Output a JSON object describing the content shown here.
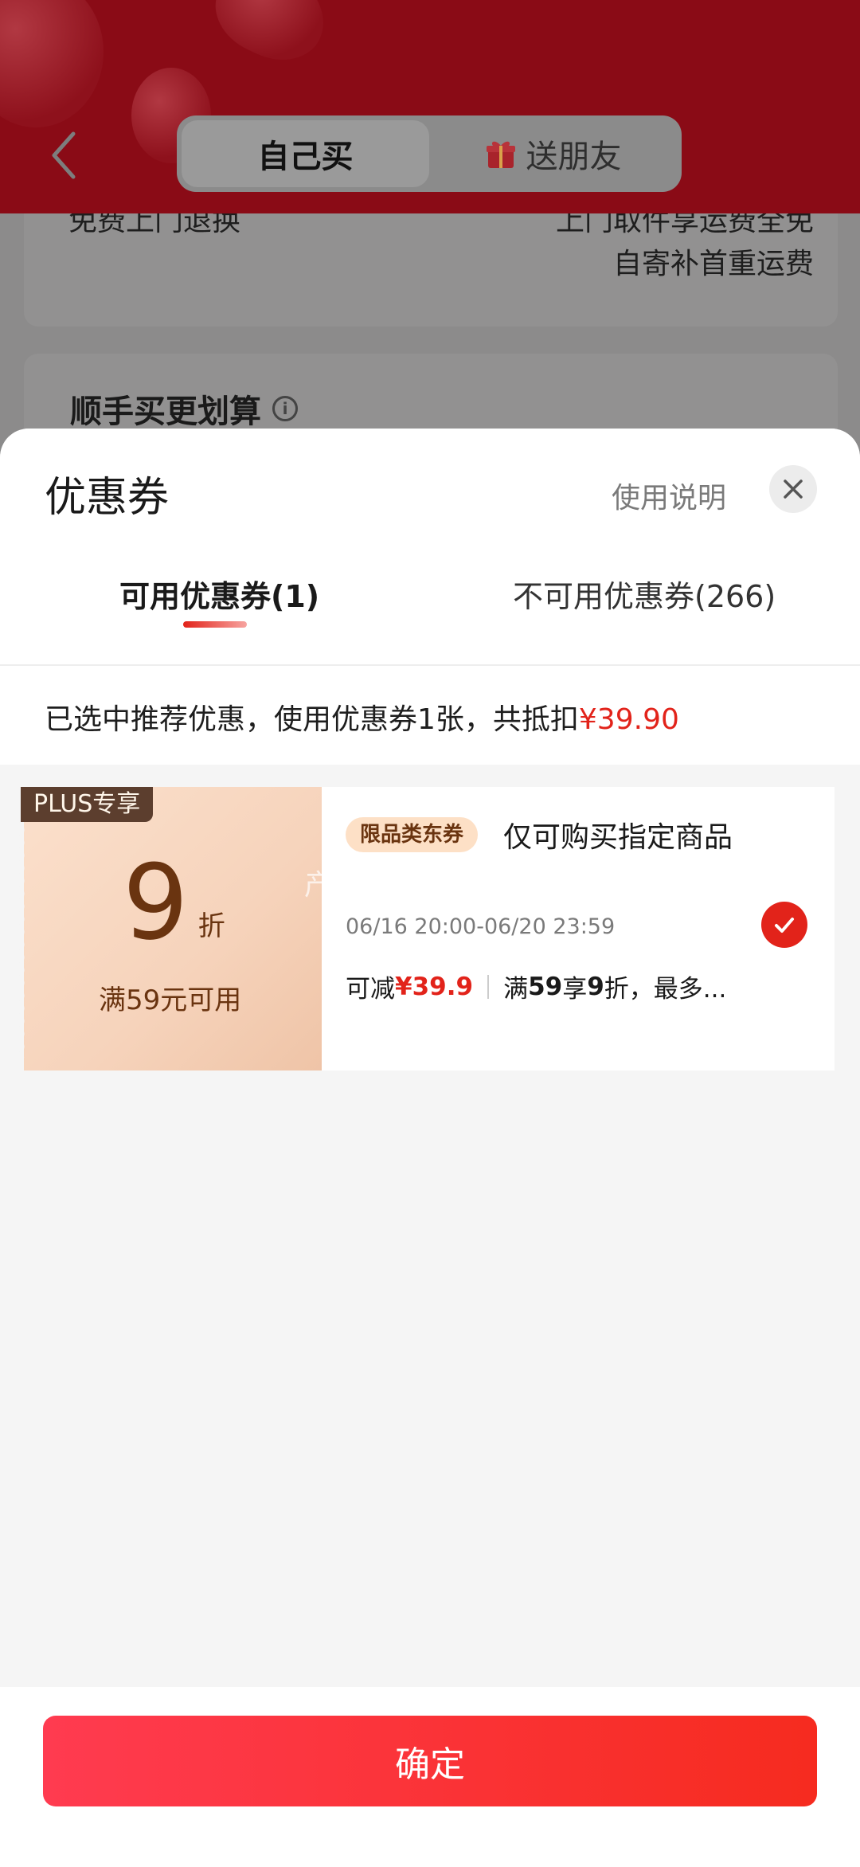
{
  "background": {
    "segment_tabs": [
      "自己买",
      "送朋友"
    ],
    "free_return_label": "免费上门退换",
    "free_return_note_line1": "上门取件享运费全免",
    "free_return_note_line2": "自寄补首重运费",
    "bundle_title": "顺手买更划算"
  },
  "sheet": {
    "title": "优惠券",
    "help_link": "使用说明",
    "tabs": [
      {
        "label": "可用优惠券(1)",
        "active": true
      },
      {
        "label": "不可用优惠券(266)",
        "active": false
      }
    ],
    "summary_prefix": "已选中推荐优惠，使用优惠券1张，共抵扣",
    "summary_amount": "¥39.90"
  },
  "coupon": {
    "plus_tag": "PLUS专享",
    "discount_value": "9",
    "discount_unit": "折",
    "threshold": "满59元可用",
    "scope_badge": "限品类东券",
    "title": "仅可购买指定商品",
    "validity": "06/16 20:00-06/20 23:59",
    "reduce_label": "可减",
    "reduce_amount": "¥39.9",
    "rule_prefix": "满",
    "rule_threshold": "59",
    "rule_mid": "享",
    "rule_discount": "9",
    "rule_suffix": "折，最多...",
    "selected": true
  },
  "watermark": "产品性能优势",
  "confirm_label": "确定",
  "colors": {
    "accent": "#e2231a",
    "coupon_brown": "#6a3410"
  }
}
